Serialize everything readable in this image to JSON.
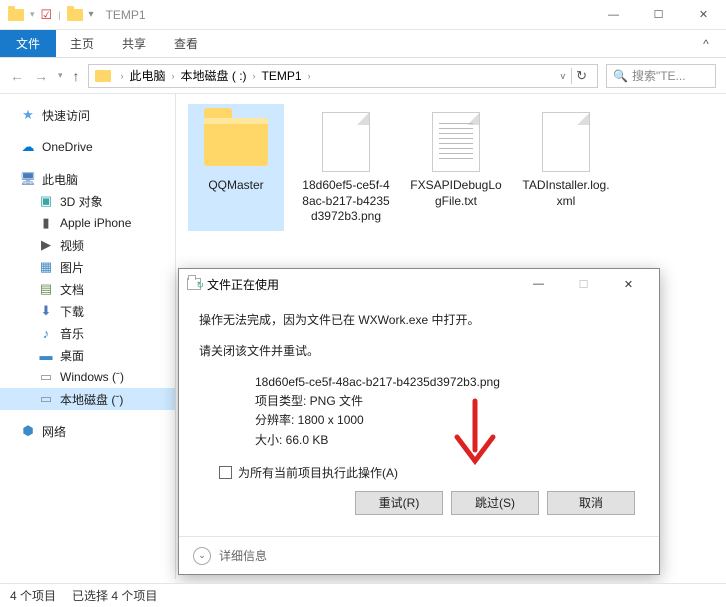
{
  "window": {
    "title": "TEMP1",
    "min": "—",
    "max": "☐",
    "close": "✕"
  },
  "ribbon": {
    "file": "文件",
    "tabs": [
      "主页",
      "共享",
      "查看"
    ]
  },
  "address": {
    "crumbs": [
      "此电脑",
      "本地磁盘 ( :)",
      "TEMP1"
    ],
    "search_placeholder": "搜索\"TE..."
  },
  "nav": {
    "quick": "快速访问",
    "onedrive": "OneDrive",
    "pc": "此电脑",
    "pc_children": [
      "3D 对象",
      "Apple iPhone",
      "视频",
      "图片",
      "文档",
      "下载",
      "音乐",
      "桌面",
      "Windows (ˉ)",
      "本地磁盘 (ˉ)"
    ],
    "network": "网络"
  },
  "files": [
    {
      "name": "QQMaster",
      "type": "folder"
    },
    {
      "name": "18d60ef5-ce5f-48ac-b217-b4235d3972b3.png",
      "type": "file"
    },
    {
      "name": "FXSAPIDebugLogFile.txt",
      "type": "file"
    },
    {
      "name": "TADInstaller.log.xml",
      "type": "file"
    }
  ],
  "dialog": {
    "title": "文件正在使用",
    "message": "操作无法完成，因为文件已在 WXWork.exe 中打开。",
    "instruction": "请关闭该文件并重试。",
    "filename": "18d60ef5-ce5f-48ac-b217-b4235d3972b3.png",
    "type_label": "项目类型: PNG 文件",
    "resolution": "分辨率: 1800 x 1000",
    "size": "大小: 66.0 KB",
    "checkbox": "为所有当前项目执行此操作(A)",
    "retry": "重试(R)",
    "skip": "跳过(S)",
    "cancel": "取消",
    "more": "详细信息"
  },
  "status": {
    "count": "4 个项目",
    "selected": "已选择 4 个项目"
  }
}
